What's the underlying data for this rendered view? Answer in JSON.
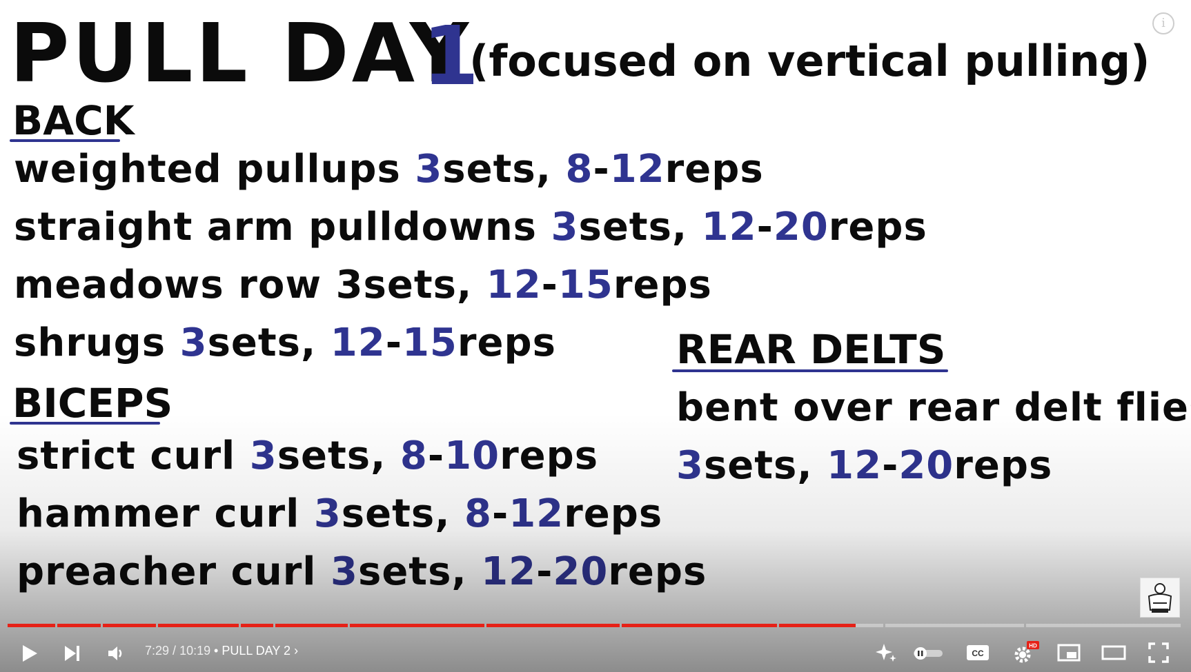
{
  "slide": {
    "title_main": "PULL DAY",
    "title_number": "1",
    "title_sub": "(focused on vertical pulling)",
    "back": {
      "heading": "BACK",
      "items": [
        {
          "name": "weighted pullups",
          "sets": "3",
          "sets_unit": "sets,",
          "reps_a": "8",
          "dash": "-",
          "reps_b": "12",
          "reps_unit": "reps"
        },
        {
          "name": "straight arm pulldowns",
          "sets": "3",
          "sets_unit": "sets,",
          "reps_a": "12",
          "dash": "-",
          "reps_b": "20",
          "reps_unit": "reps"
        },
        {
          "name": "meadows row",
          "sets": "3",
          "sets_unit": "sets,",
          "reps_a": "12",
          "dash": "-",
          "reps_b": "15",
          "reps_unit": "reps"
        },
        {
          "name": "shrugs",
          "sets": "3",
          "sets_unit": "sets,",
          "reps_a": "12",
          "dash": "-",
          "reps_b": "15",
          "reps_unit": "reps"
        }
      ]
    },
    "biceps": {
      "heading": "BICEPS",
      "items": [
        {
          "name": "strict curl",
          "sets": "3",
          "sets_unit": "sets,",
          "reps_a": "8",
          "dash": "-",
          "reps_b": "10",
          "reps_unit": "reps"
        },
        {
          "name": "hammer curl",
          "sets": "3",
          "sets_unit": "sets,",
          "reps_a": "8",
          "dash": "-",
          "reps_b": "12",
          "reps_unit": "reps"
        },
        {
          "name": "preacher curl",
          "sets": "3",
          "sets_unit": "sets,",
          "reps_a": "12",
          "dash": "-",
          "reps_b": "20",
          "reps_unit": "reps"
        }
      ]
    },
    "rear_delts": {
      "heading": "REAR DELTS",
      "line1": "bent over rear delt flies",
      "sets": "3",
      "sets_unit": "sets,",
      "reps_a": "12",
      "dash": "-",
      "reps_b": "20",
      "reps_unit": "reps"
    }
  },
  "player": {
    "current_time": "7:29",
    "separator": " / ",
    "duration": "10:19",
    "chapter_bullet": "•",
    "chapter": "PULL DAY 2",
    "chapter_arrow": "›",
    "progress_fraction": 0.725,
    "cc_label": "CC",
    "hd_badge": "HD",
    "icons": [
      "play-icon",
      "next-icon",
      "volume-icon",
      "sparkle-icon",
      "autoplay-toggle",
      "cc-icon",
      "settings-icon",
      "miniplayer-icon",
      "theater-icon",
      "fullscreen-icon",
      "info-icon"
    ],
    "colors": {
      "played": "#e62117",
      "title_blue": "#2f3490",
      "hd_badge": "#e62117"
    }
  }
}
